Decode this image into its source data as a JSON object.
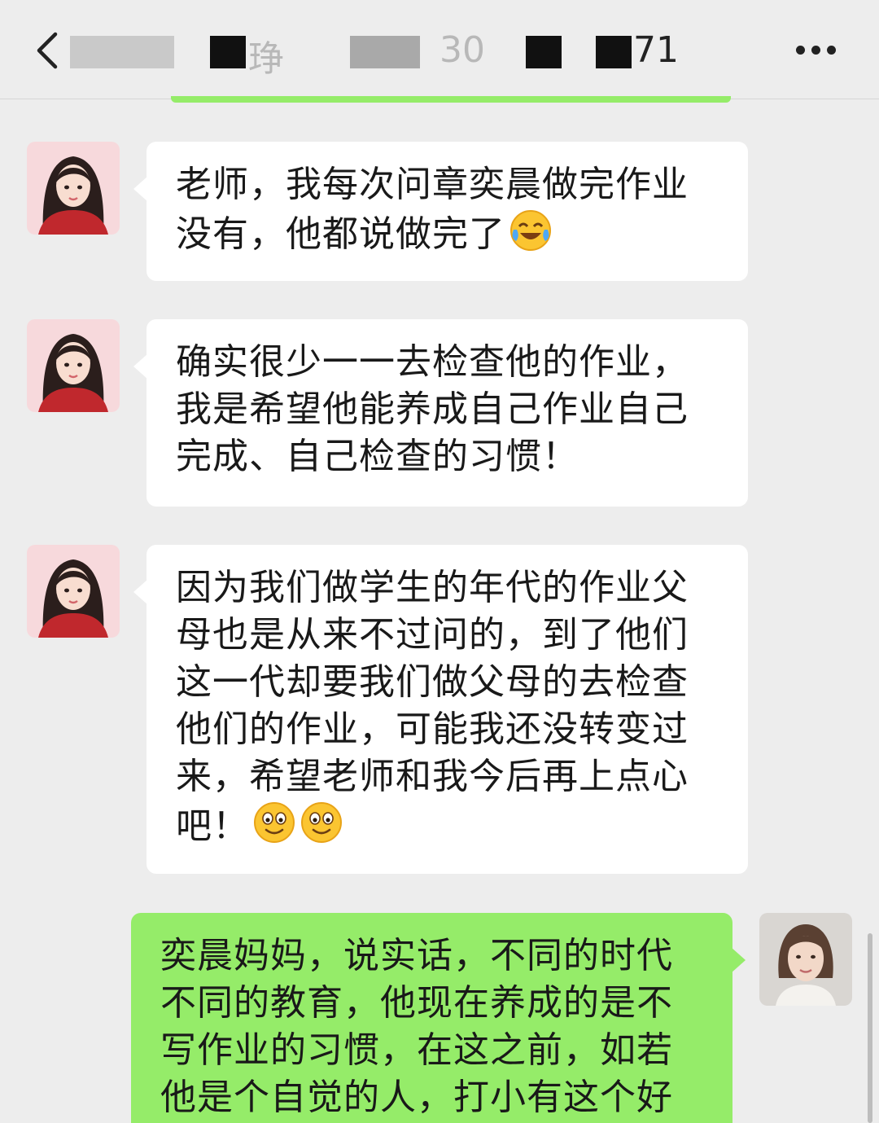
{
  "header": {
    "title_fragments": [
      "琤",
      "30",
      "71"
    ],
    "back_icon": "chevron-left-icon",
    "more_icon": "more-dots-icon"
  },
  "messages": [
    {
      "side": "left",
      "lines": [
        "老师，我每次问章奕晨做完作业",
        "没有，他都说做完了"
      ],
      "emoji": [
        "face-with-tears-of-joy"
      ]
    },
    {
      "side": "left",
      "lines": [
        "确实很少一一去检查他的作业，",
        "我是希望他能养成自己作业自己",
        "完成、自己检查的习惯！"
      ],
      "emoji": []
    },
    {
      "side": "left",
      "lines": [
        "因为我们做学生的年代的作业父",
        "母也是从来不过问的，到了他们",
        "这一代却要我们做父母的去检查",
        "他们的作业，可能我还没转变过",
        "来，希望老师和我今后再上点心",
        "吧！"
      ],
      "emoji": [
        "smiling-face",
        "smiling-face"
      ]
    },
    {
      "side": "right",
      "lines": [
        "奕晨妈妈，说实话，不同的时代",
        "不同的教育，他现在养成的是不",
        "写作业的习惯，在这之前，如若",
        "他是个自觉的人，打小有这个好"
      ],
      "emoji": []
    }
  ],
  "colors": {
    "background": "#ededed",
    "bubble_self": "#95ec69",
    "bubble_other": "#ffffff"
  }
}
